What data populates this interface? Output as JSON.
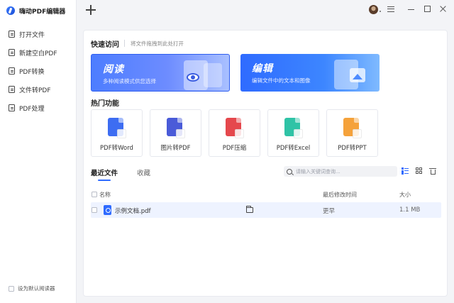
{
  "app": {
    "title": "嗨动PDF编辑器"
  },
  "sidebar": {
    "items": [
      {
        "label": "打开文件",
        "icon": "open-file-icon"
      },
      {
        "label": "新建空白PDF",
        "icon": "new-pdf-icon"
      },
      {
        "label": "PDF转换",
        "icon": "pdf-convert-icon"
      },
      {
        "label": "文件转PDF",
        "icon": "file-to-pdf-icon"
      },
      {
        "label": "PDF处理",
        "icon": "pdf-process-icon"
      }
    ],
    "default_reader_label": "设为默认阅读器"
  },
  "quick_access": {
    "title": "快速访问",
    "hint": "将文件拖拽到此处打开",
    "read": {
      "title": "阅读",
      "subtitle": "多种阅读模式供您选择"
    },
    "edit": {
      "title": "编辑",
      "subtitle": "编辑文件中的文本和图像"
    }
  },
  "hot": {
    "title": "热门功能",
    "tools": [
      {
        "label": "PDF转Word",
        "color": "#3d6df2"
      },
      {
        "label": "图片转PDF",
        "color": "#4a5bd8"
      },
      {
        "label": "PDF压缩",
        "color": "#e5484d"
      },
      {
        "label": "PDF转Excel",
        "color": "#2fc3a6"
      },
      {
        "label": "PDF转PPT",
        "color": "#f5a23b"
      }
    ]
  },
  "files": {
    "tab_recent": "最近文件",
    "tab_favorites": "收藏",
    "search_placeholder": "请输入关键词查询...",
    "col_name": "名称",
    "col_modified": "最后修改时间",
    "col_size": "大小",
    "rows": [
      {
        "name": "示例文档.pdf",
        "modified": "更早",
        "size": "1.1 MB"
      }
    ]
  },
  "colors": {
    "accent": "#2f6bff"
  }
}
